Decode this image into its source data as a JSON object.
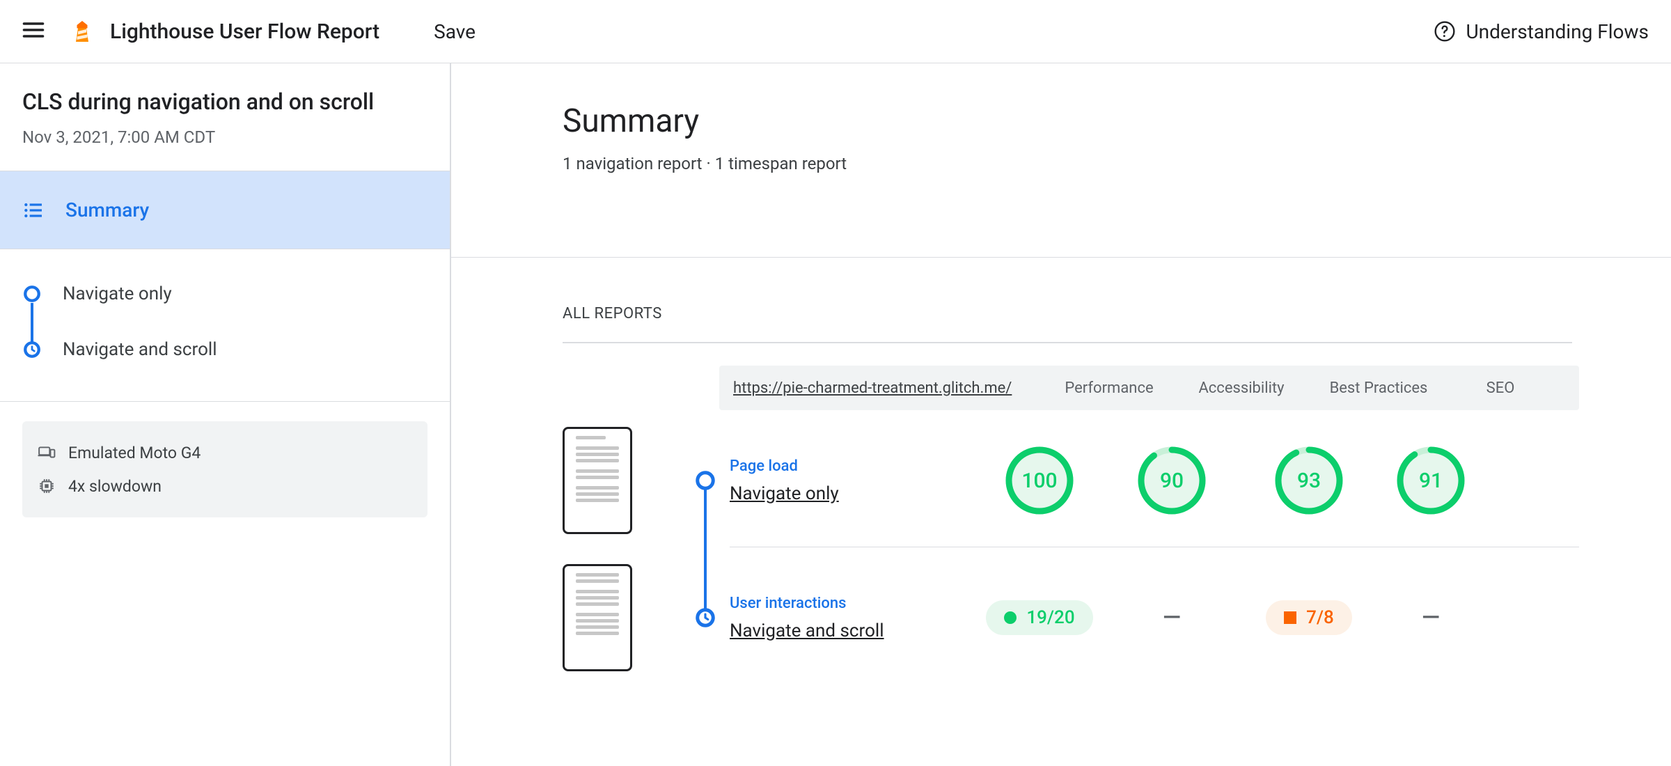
{
  "header": {
    "app_title": "Lighthouse User Flow Report",
    "save": "Save",
    "help": "Understanding Flows"
  },
  "sidebar": {
    "flow_title": "CLS during navigation and on scroll",
    "flow_date": "Nov 3, 2021, 7:00 AM CDT",
    "summary_label": "Summary",
    "steps": [
      {
        "label": "Navigate only",
        "type": "navigation"
      },
      {
        "label": "Navigate and scroll",
        "type": "timespan"
      }
    ],
    "env": {
      "device": "Emulated Moto G4",
      "cpu": "4x slowdown"
    }
  },
  "main": {
    "title": "Summary",
    "subtitle": "1 navigation report · 1 timespan report",
    "all_reports_label": "ALL REPORTS",
    "url": "https://pie-charmed-treatment.glitch.me/",
    "columns": [
      "Performance",
      "Accessibility",
      "Best Practices",
      "SEO"
    ],
    "rows": [
      {
        "category": "Page load",
        "name": "Navigate only",
        "type": "navigation",
        "scores": {
          "performance": 100,
          "accessibility": 90,
          "best_practices": 93,
          "seo": 91
        }
      },
      {
        "category": "User interactions",
        "name": "Navigate and scroll",
        "type": "timespan",
        "fractions": {
          "performance": "19/20",
          "best_practices": "7/8"
        }
      }
    ]
  },
  "icons": {
    "dash": "—"
  }
}
